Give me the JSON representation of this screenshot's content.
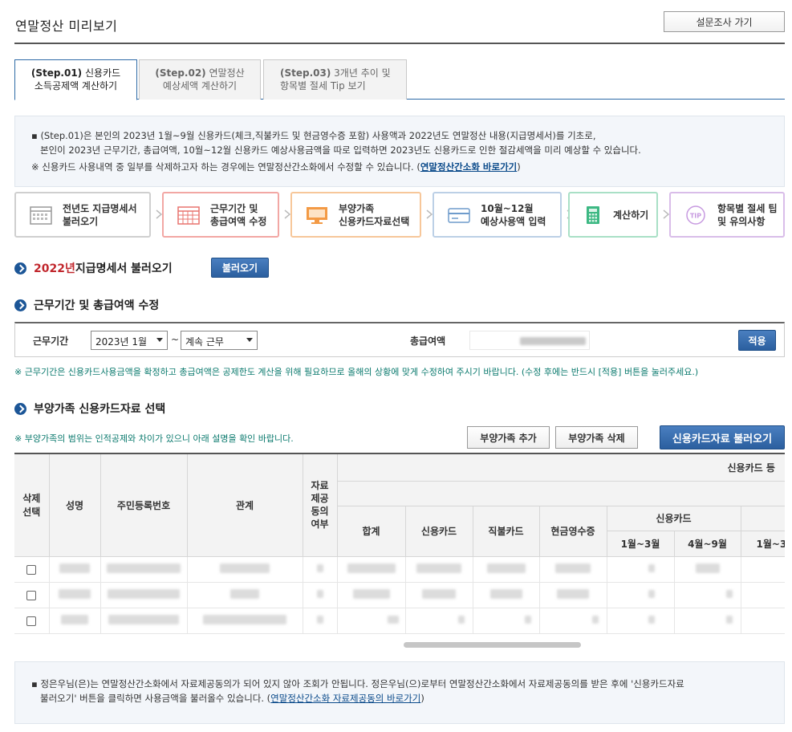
{
  "header": {
    "title": "연말정산 미리보기",
    "survey_button": "설문조사 가기"
  },
  "tabs": [
    {
      "step": "(Step.01)",
      "line1": " 신용카드",
      "line2": "소득공제액 계산하기",
      "active": true
    },
    {
      "step": "(Step.02)",
      "line1": " 연말정산",
      "line2": "예상세액 계산하기",
      "active": false
    },
    {
      "step": "(Step.03)",
      "line1": " 3개년 추이 및",
      "line2": "항목별 절세 Tip 보기",
      "active": false
    }
  ],
  "info": {
    "line1": "▪ (Step.01)은 본인의 2023년 1월~9월 신용카드(체크,직불카드 및 현금영수증 포함) 사용액과 2022년도 연말정산 내용(지급명세서)를 기초로,",
    "line2": "본인이 2023년 근무기간, 총급여액, 10월~12월 신용카드 예상사용금액을 따로 입력하면 2023년도 신용카드로 인한 절감세액을 미리 예상할 수 있습니다.",
    "line3": "※ 신용카드 사용내역 중 일부를 삭제하고자 하는 경우에는 연말정산간소화에서 수정할 수 있습니다. (",
    "line3_link": "연말정산간소화 바로가기",
    "line3_end": ")"
  },
  "steps": [
    {
      "line1": "전년도 지급명세서",
      "line2": "불러오기",
      "icon": "calendar-icon",
      "color": "#cfcfcf"
    },
    {
      "line1": "근무기간 및",
      "line2": "총급여액 수정",
      "icon": "calendar-grid-icon",
      "color": "#f2a7a4"
    },
    {
      "line1": "부양가족",
      "line2": "신용카드자료선택",
      "icon": "monitor-icon",
      "color": "#f7c79a"
    },
    {
      "line1": "10월~12월",
      "line2": "예상사용액 입력",
      "icon": "card-icon",
      "color": "#bcd0e6"
    },
    {
      "line1": "계산하기",
      "line2": "",
      "icon": "calculator-icon",
      "color": "#a9e0c6"
    },
    {
      "line1": "항목별 절세 팁",
      "line2": "및 유의사항",
      "icon": "tip-icon",
      "color": "#d9bde9"
    }
  ],
  "section1": {
    "year": "2022년",
    "title": " 지급명세서 불러오기",
    "button": "불러오기"
  },
  "section2": {
    "title": "근무기간 및 총급여액 수정",
    "period_label": "근무기간",
    "start_value": "2023년 1월",
    "tilde": "~",
    "end_value": "계속 근무",
    "salary_label": "총급여액",
    "apply_button": "적용",
    "note": "※ 근무기간은 신용카드사용금액을 확정하고 총급여액은 공제한도 계산을 위해 필요하므로 올해의 상황에 맞게 수정하여 주시기 바랍니다. (수정 후에는 반드시 [적용] 버튼을 눌러주세요.)"
  },
  "section3": {
    "title": "부양가족 신용카드자료 선택",
    "note": "※ 부양가족의 범위는 인적공제와 차이가 있으니 아래 설명을 확인 바랍니다.",
    "add_button": "부양가족 추가",
    "delete_button": "부양가족 삭제",
    "load_button": "신용카드자료 불러오기"
  },
  "table": {
    "h_delete": [
      "삭제",
      "선택"
    ],
    "h_name": "성명",
    "h_id": "주민등록번호",
    "h_relation": "관계",
    "h_consent": [
      "자료",
      "제공",
      "동의",
      "여부"
    ],
    "h_group_top": "신용카드 등",
    "h_group_mid": "5",
    "h_total": "합계",
    "h_credit": "신용카드",
    "h_debit": "직불카드",
    "h_cash": "현금영수증",
    "h_sub_credit": "신용카드",
    "h_m13": "1월~3월",
    "h_m49": "4월~9월",
    "h_m13b": "1월~3"
  },
  "bottom": {
    "text1": "▪ 정은우님(은)는 연말정산간소화에서 자료제공동의가 되어 있지 않아 조회가 안됩니다. 정은우님(으)로부터 연말정산간소화에서 자료제공동의를 받은 후에 '신용카드자료",
    "text2": "불러오기' 버튼을 클릭하면 사용금액을 불러올수 있습니다. (",
    "link": "연말정산간소화 자료제공동의 바로가기",
    "end": ")"
  }
}
